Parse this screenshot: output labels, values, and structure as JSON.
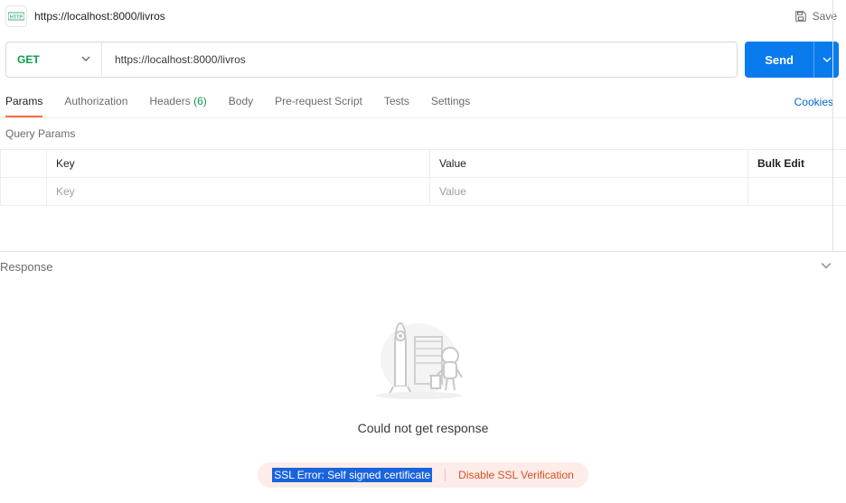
{
  "header": {
    "title": "https://localhost:8000/livros",
    "save_label": "Save"
  },
  "request": {
    "method": "GET",
    "url": "https://localhost:8000/livros",
    "send_label": "Send"
  },
  "tabs": {
    "params": "Params",
    "authorization": "Authorization",
    "headers_label": "Headers",
    "headers_count": "(6)",
    "body": "Body",
    "prerequest": "Pre-request Script",
    "tests": "Tests",
    "settings": "Settings",
    "cookies": "Cookies"
  },
  "query_params": {
    "title": "Query Params",
    "header_key": "Key",
    "header_value": "Value",
    "bulk_edit": "Bulk Edit",
    "placeholder_key": "Key",
    "placeholder_value": "Value"
  },
  "response": {
    "label": "Response",
    "message": "Could not get response",
    "ssl_error": "SSL Error: Self signed certificate",
    "disable_ssl": "Disable SSL Verification"
  }
}
